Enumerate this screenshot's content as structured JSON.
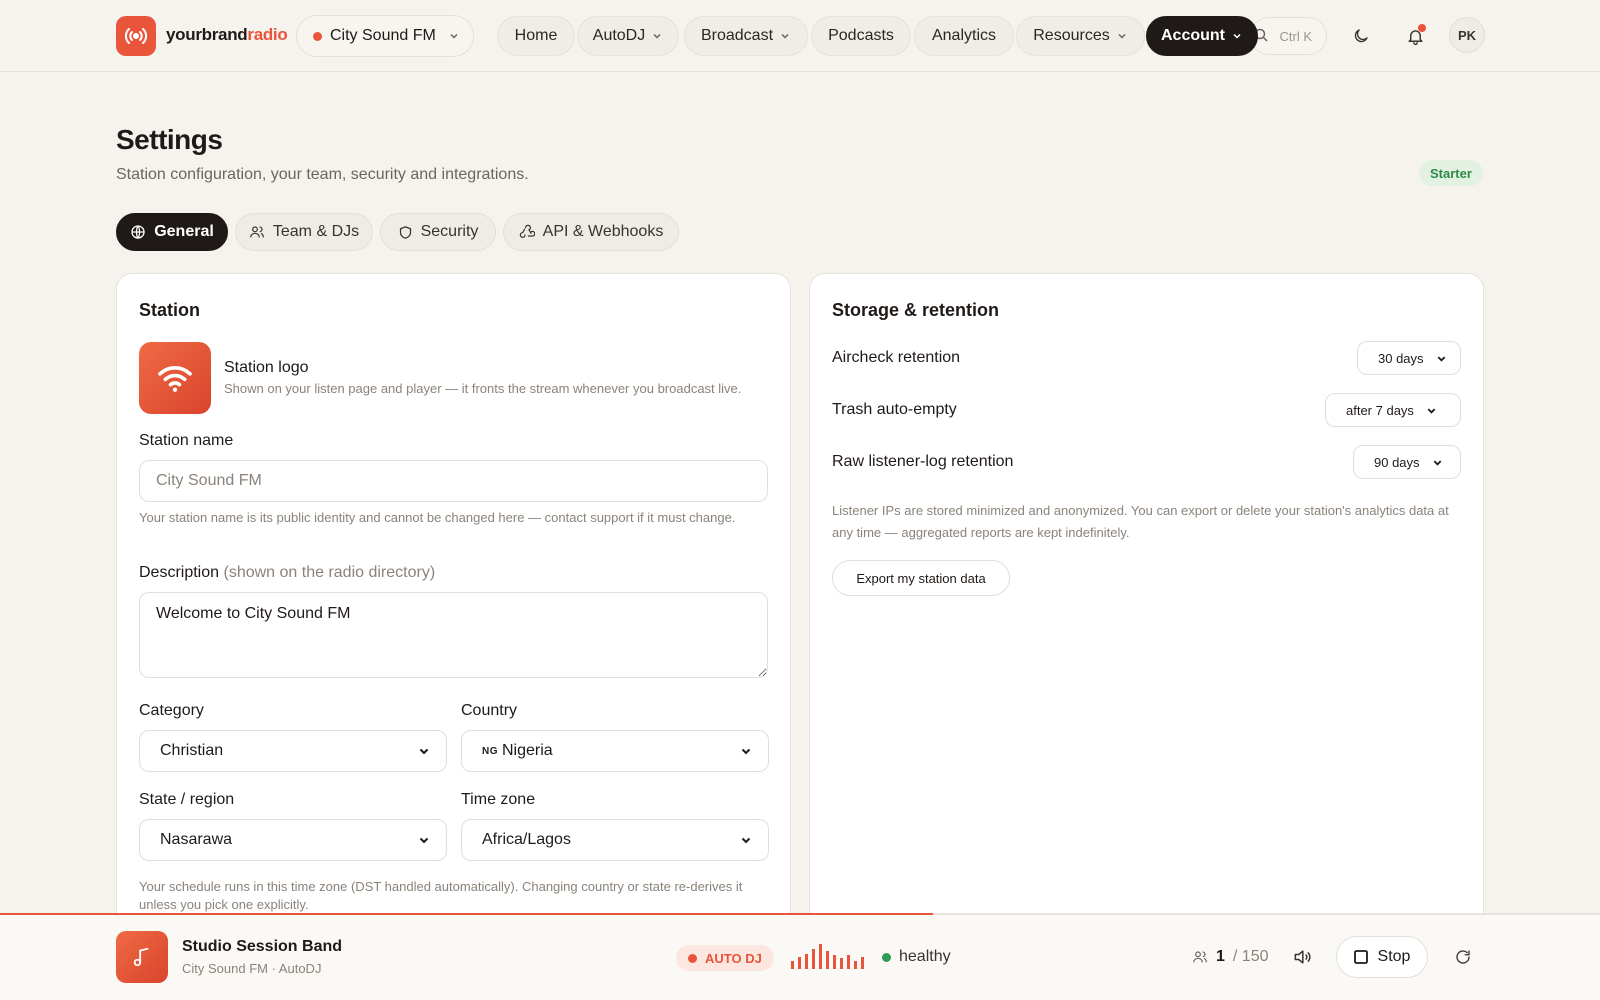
{
  "brand": {
    "name_part1": "yourbrand",
    "name_part2": "radio",
    "accent": "#e8553a"
  },
  "station_selector": {
    "label": "City Sound FM"
  },
  "nav": {
    "items": [
      {
        "label": "Home"
      },
      {
        "label": "AutoDJ"
      },
      {
        "label": "Broadcast"
      },
      {
        "label": "Podcasts"
      },
      {
        "label": "Analytics"
      },
      {
        "label": "Resources"
      },
      {
        "label": "Account"
      }
    ]
  },
  "search": {
    "shortcut": "Ctrl K"
  },
  "user": {
    "initials": "PK"
  },
  "header": {
    "title": "Settings",
    "subtitle": "Station configuration, your team, security and integrations.",
    "plan": "Starter"
  },
  "tabs": [
    {
      "label": "General"
    },
    {
      "label": "Team & DJs"
    },
    {
      "label": "Security"
    },
    {
      "label": "API & Webhooks"
    }
  ],
  "station_card": {
    "title": "Station",
    "logo_label": "Station logo",
    "logo_help": "Shown on your listen page and player — it fronts the stream whenever you broadcast live.",
    "name_label": "Station name",
    "name_placeholder": "City Sound FM",
    "name_help": "Your station name is its public identity and cannot be changed here — contact support if it must change.",
    "description_label": "Description",
    "description_hint": "(shown on the radio directory)",
    "description_value": "Welcome to City Sound FM",
    "category_label": "Category",
    "category_value": "Christian",
    "country_label": "Country",
    "country_flag": "NG",
    "country_value": "Nigeria",
    "state_label": "State / region",
    "state_value": "Nasarawa",
    "timezone_label": "Time zone",
    "timezone_value": "Africa/Lagos",
    "timezone_help": "Your schedule runs in this time zone (DST handled automatically). Changing country or state re-derives it unless you pick one explicitly."
  },
  "storage_card": {
    "title": "Storage & retention",
    "rows": [
      {
        "label": "Aircheck retention",
        "value": "30 days"
      },
      {
        "label": "Trash auto-empty",
        "value": "after 7 days"
      },
      {
        "label": "Raw listener-log retention",
        "value": "90 days"
      }
    ],
    "note": "Listener IPs are stored minimized and anonymized. You can export or delete your station's analytics data at any time — aggregated reports are kept indefinitely.",
    "export_label": "Export my station data"
  },
  "player": {
    "progress": 0.583,
    "track_title": "Studio Session Band",
    "track_sub": "City Sound FM · AutoDJ",
    "mode_badge": "AUTO DJ",
    "status": "healthy",
    "listeners_current": "1",
    "listeners_max": "/ 150",
    "stop_label": "Stop"
  }
}
